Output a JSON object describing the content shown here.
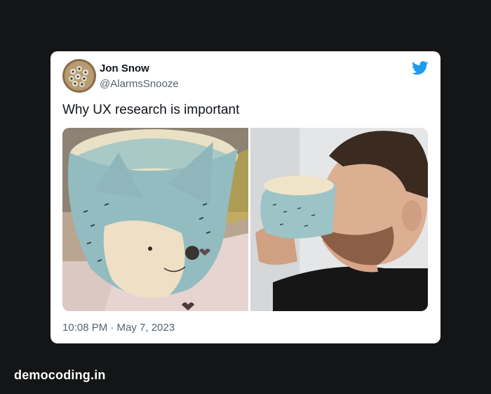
{
  "tweet": {
    "author": {
      "name": "Jon Snow",
      "handle": "@AlarmsSnooze",
      "avatar": "avatar-image"
    },
    "brand_icon": "twitter-bird-icon",
    "brand_color": "#1d9bf0",
    "text": "Why UX research is important",
    "media": {
      "left_image": "cat-shaped-ceramic-mug-image",
      "right_image": "man-drinking-from-mug-image"
    },
    "timestamp": "10:08 PM · May 7, 2023"
  },
  "watermark": "democoding.in",
  "colors": {
    "page_background": "#141516",
    "card_background": "#ffffff",
    "primary_text": "#0f1419",
    "secondary_text": "#536471"
  }
}
